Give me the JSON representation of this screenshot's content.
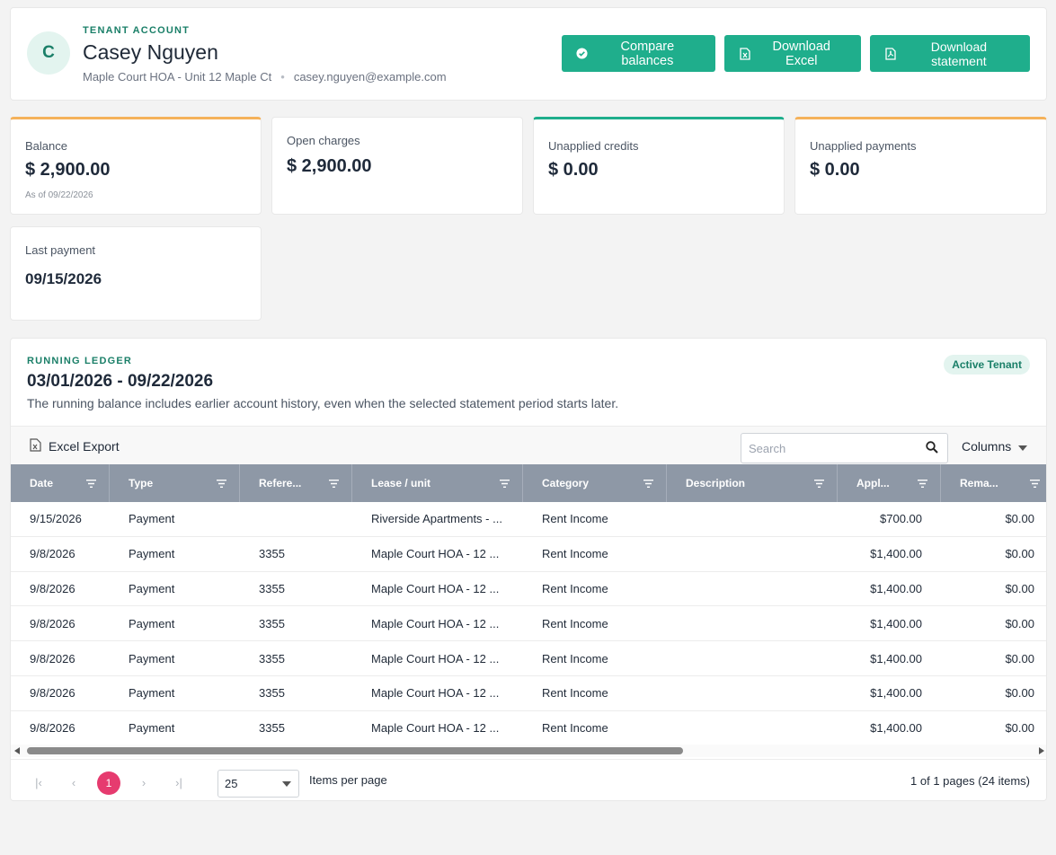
{
  "header": {
    "avatar_initial": "C",
    "eyebrow": "TENANT ACCOUNT",
    "name": "Casey Nguyen",
    "property": "Maple Court HOA - Unit 12 Maple Ct",
    "separator": "•",
    "email": "casey.nguyen@example.com",
    "actions": {
      "compare": "Compare balances",
      "excel": "Download Excel",
      "statement": "Download statement"
    }
  },
  "stats": [
    {
      "label": "Balance",
      "value": "$ 2,900.00",
      "sub": "As of 09/22/2026"
    },
    {
      "label": "Open charges",
      "value": "$ 2,900.00"
    },
    {
      "label": "Unapplied credits",
      "value": "$ 0.00"
    },
    {
      "label": "Unapplied payments",
      "value": "$ 0.00"
    },
    {
      "label": "Last payment",
      "value": "09/15/2026"
    }
  ],
  "ledger": {
    "eyebrow": "RUNNING LEDGER",
    "range": "03/01/2026 - 09/22/2026",
    "note": "The running balance includes earlier account history, even when the selected statement period starts later.",
    "badge": "Active Tenant",
    "toolbar": {
      "excel_export": "Excel Export",
      "search_placeholder": "Search",
      "columns": "Columns"
    },
    "columns": [
      "Date",
      "Type",
      "Refere...",
      "Lease / unit",
      "Category",
      "Description",
      "Appl...",
      "Rema..."
    ],
    "rows": [
      [
        "9/15/2026",
        "Payment",
        "",
        "Riverside Apartments - ...",
        "Rent Income",
        "",
        "$700.00",
        "$0.00"
      ],
      [
        "9/8/2026",
        "Payment",
        "3355",
        "Maple Court HOA - 12 ...",
        "Rent Income",
        "",
        "$1,400.00",
        "$0.00"
      ],
      [
        "9/8/2026",
        "Payment",
        "3355",
        "Maple Court HOA - 12 ...",
        "Rent Income",
        "",
        "$1,400.00",
        "$0.00"
      ],
      [
        "9/8/2026",
        "Payment",
        "3355",
        "Maple Court HOA - 12 ...",
        "Rent Income",
        "",
        "$1,400.00",
        "$0.00"
      ],
      [
        "9/8/2026",
        "Payment",
        "3355",
        "Maple Court HOA - 12 ...",
        "Rent Income",
        "",
        "$1,400.00",
        "$0.00"
      ],
      [
        "9/8/2026",
        "Payment",
        "3355",
        "Maple Court HOA - 12 ...",
        "Rent Income",
        "",
        "$1,400.00",
        "$0.00"
      ],
      [
        "9/8/2026",
        "Payment",
        "3355",
        "Maple Court HOA - 12 ...",
        "Rent Income",
        "",
        "$1,400.00",
        "$0.00"
      ]
    ],
    "pager": {
      "first": "|‹",
      "prev": "‹",
      "current_page": "1",
      "next": "›",
      "last": "›|",
      "page_size": "25",
      "items_per_page_label": "Items per page",
      "info": "1 of 1 pages (24 items)"
    }
  },
  "colors": {
    "accent": "#1fae8c",
    "accent_dark": "#1a7f68",
    "warning": "#f5b25b",
    "grid_header": "#8e98a6",
    "pager_current": "#e63b6f"
  },
  "icons": {
    "compare": "check-circle-icon",
    "excel": "excel-file-icon",
    "statement": "pdf-file-icon",
    "search": "search-icon",
    "filter": "filter-icon",
    "columns": "chevron-down-icon"
  }
}
